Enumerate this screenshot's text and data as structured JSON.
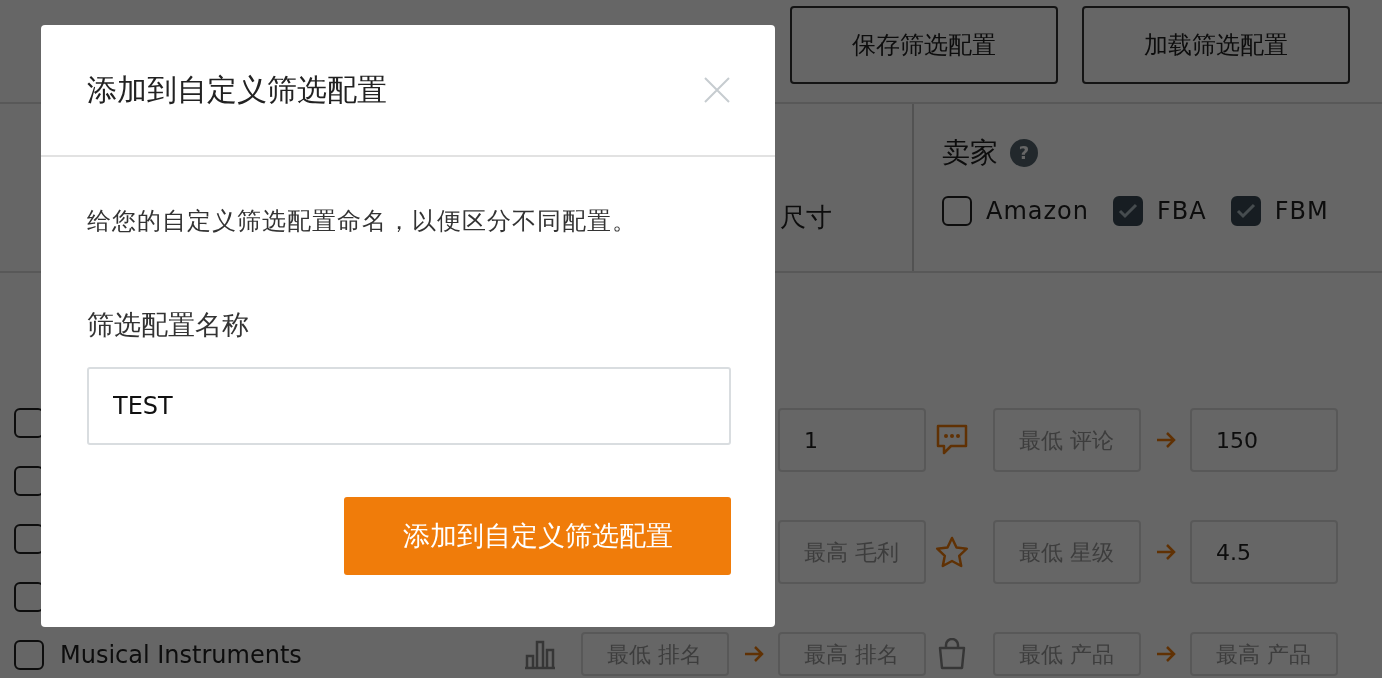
{
  "toolbar": {
    "buttons": [
      "保存筛选配置",
      "加载筛选配置"
    ]
  },
  "filter_header": {
    "size_label": "尺寸",
    "seller": {
      "title": "卖家",
      "help": "?",
      "options": [
        {
          "label": "Amazon",
          "checked": false
        },
        {
          "label": "FBA",
          "checked": true
        },
        {
          "label": "FBM",
          "checked": true
        }
      ]
    }
  },
  "categories": [
    {
      "checked": false
    },
    {
      "checked": false
    },
    {
      "checked": false
    },
    {
      "checked": false
    },
    {
      "label": "Musical Instruments",
      "checked": false
    }
  ],
  "range_filters": [
    {
      "max": {
        "value": "1"
      }
    },
    {
      "kind": "comment",
      "min": {
        "placeholder": "最低 评论"
      },
      "max": {
        "value": "150"
      }
    },
    {
      "max": {
        "placeholder": "最高 毛利"
      }
    },
    {
      "kind": "star",
      "min": {
        "placeholder": "最低 星级"
      },
      "max": {
        "value": "4.5"
      }
    },
    {
      "kind": "bars",
      "min": {
        "placeholder": "最低 排名"
      },
      "max": {
        "placeholder": "最高 排名"
      }
    },
    {
      "kind": "bag",
      "min": {
        "placeholder": "最低 产品"
      },
      "max": {
        "placeholder": "最高 产品"
      }
    }
  ],
  "dialog": {
    "title": "添加到自定义筛选配置",
    "description": "给您的自定义筛选配置命名，以便区分不同配置。",
    "field_label": "筛选配置名称",
    "field_value": "TEST",
    "submit_button": "添加到自定义筛选配置"
  }
}
